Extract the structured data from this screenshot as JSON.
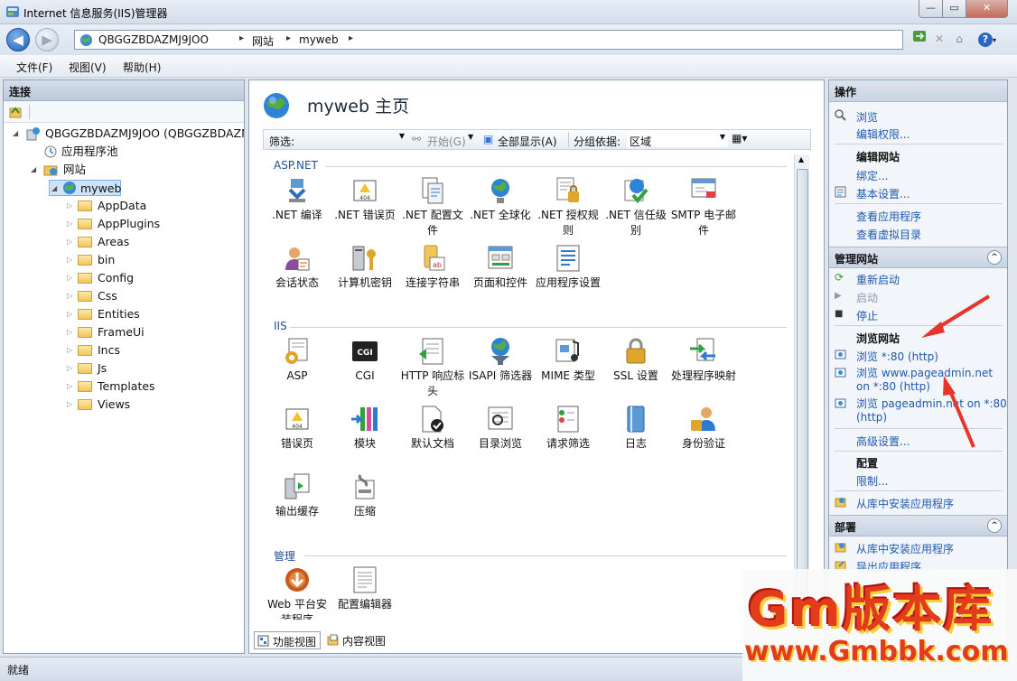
{
  "window": {
    "title": "Internet 信息服务(IIS)管理器",
    "min": "0",
    "max": "1",
    "close": "r"
  },
  "nav": {
    "back": "◀",
    "forward": "▶",
    "breadcrumbs": [
      "QBGGZBDAZMJ9JOO",
      "网站",
      "myweb"
    ],
    "sep": "▸",
    "help": "?"
  },
  "menu": {
    "items": [
      "文件(F)",
      "视图(V)",
      "帮助(H)"
    ]
  },
  "connections": {
    "title": "连接",
    "server": "QBGGZBDAZMJ9JOO (QBGGZBDAZM...",
    "app_pools": "应用程序池",
    "sites": "网站",
    "site": "myweb",
    "folders": [
      "AppData",
      "AppPlugins",
      "Areas",
      "bin",
      "Config",
      "Css",
      "Entities",
      "FrameUi",
      "Incs",
      "Js",
      "Templates",
      "Views"
    ]
  },
  "center": {
    "title": "myweb 主页",
    "filter": {
      "label": "筛选:",
      "start": "开始(G)",
      "show_all": "全部显示(A)",
      "group_by": "分组依据:",
      "group_value": "区域"
    },
    "sections": [
      {
        "name": "ASP.NET",
        "features": [
          ".NET 编译",
          ".NET 错误页",
          ".NET 配置文件",
          ".NET 全球化",
          ".NET 授权规则",
          ".NET 信任级别",
          "SMTP 电子邮件",
          "会话状态",
          "计算机密钥",
          "连接字符串",
          "页面和控件",
          "应用程序设置"
        ]
      },
      {
        "name": "IIS",
        "features": [
          "ASP",
          "CGI",
          "HTTP 响应标头",
          "ISAPI 筛选器",
          "MIME 类型",
          "SSL 设置",
          "处理程序映射",
          "错误页",
          "模块",
          "默认文档",
          "目录浏览",
          "请求筛选",
          "日志",
          "身份验证",
          "输出缓存",
          "压缩"
        ]
      },
      {
        "name": "管理",
        "features": [
          "Web 平台安装程序",
          "配置编辑器"
        ]
      }
    ],
    "view_tabs": [
      "功能视图",
      "内容视图"
    ]
  },
  "actions": {
    "title": "操作",
    "browse": "浏览",
    "edit_permissions": "编辑权限...",
    "edit_site": "编辑网站",
    "bindings": "绑定...",
    "basic_settings": "基本设置...",
    "view_apps": "查看应用程序",
    "view_vdirs": "查看虚拟目录",
    "manage_site": "管理网站",
    "restart": "重新启动",
    "start": "启动",
    "stop": "停止",
    "browse_site": "浏览网站",
    "browse_1": "浏览 *:80 (http)",
    "browse_2a": "浏览 www.pageadmin.net",
    "browse_2b": "on *:80 (http)",
    "browse_3a": "浏览 pageadmin.net on *:80",
    "browse_3b": "(http)",
    "advanced": "高级设置...",
    "config": "配置",
    "limits": "限制...",
    "install_gallery": "从库中安装应用程序",
    "deploy": "部署",
    "install_gallery2": "从库中安装应用程序",
    "export_app": "导出应用程序...",
    "collapse": "^"
  },
  "status": {
    "text": "就绪"
  },
  "watermark": {
    "line1": "Gm版本库",
    "line2": "www.Gmbbk.com"
  },
  "colors": {
    "link": "#1f59b0",
    "accent": "#1f4e96",
    "arrow": "#e8342a"
  }
}
